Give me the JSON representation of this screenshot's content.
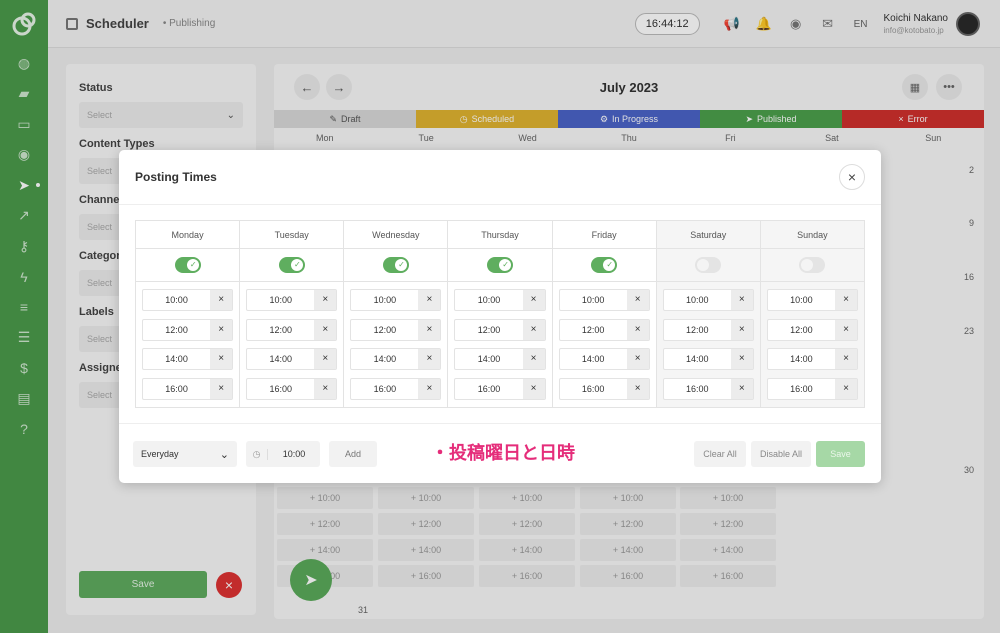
{
  "header": {
    "title": "Scheduler",
    "breadcrumb": "• Publishing",
    "clock": "16:44:12",
    "lang": "EN",
    "user_name": "Koichi Nakano",
    "user_email": "info@kotobato.jp"
  },
  "sidebar": {
    "items": [
      {
        "icon": "palette-icon",
        "glyph": "◍"
      },
      {
        "icon": "folder-icon",
        "glyph": "▰"
      },
      {
        "icon": "inbox-icon",
        "glyph": "▭"
      },
      {
        "icon": "eye-icon",
        "glyph": "◉"
      },
      {
        "icon": "send-icon",
        "glyph": "➤",
        "active": true
      },
      {
        "icon": "chart-icon",
        "glyph": "↗"
      },
      {
        "icon": "key-icon",
        "glyph": "⚷"
      },
      {
        "icon": "bolt-icon",
        "glyph": "ϟ"
      },
      {
        "icon": "sliders-icon",
        "glyph": "≡"
      },
      {
        "icon": "list-icon",
        "glyph": "☰"
      },
      {
        "icon": "dollar-icon",
        "glyph": "$"
      },
      {
        "icon": "id-card-icon",
        "glyph": "▤"
      },
      {
        "icon": "help-icon",
        "glyph": "?"
      }
    ]
  },
  "filters": {
    "status_label": "Status",
    "status_placeholder": "Select",
    "content_types_label": "Content Types",
    "channels_label": "Channels",
    "categories_label": "Categories",
    "labels_label": "Labels",
    "assignee_label": "Assignee",
    "placeholder": "Select",
    "save_label": "Save"
  },
  "calendar": {
    "month": "July 2023",
    "legend": {
      "draft": "Draft",
      "scheduled": "Scheduled",
      "in_progress": "In Progress",
      "published": "Published",
      "error": "Error"
    },
    "days": [
      "Mon",
      "Tue",
      "Wed",
      "Thu",
      "Fri",
      "Sat",
      "Sun"
    ],
    "sun_dates": [
      "2",
      "9",
      "16",
      "23",
      "30"
    ],
    "last_date": "31",
    "slots": [
      "+ 10:00",
      "+ 12:00",
      "+ 14:00",
      "+ 16:00"
    ]
  },
  "modal": {
    "title": "Posting Times",
    "days": [
      {
        "name": "Monday",
        "enabled": true,
        "times": [
          "10:00",
          "12:00",
          "14:00",
          "16:00"
        ]
      },
      {
        "name": "Tuesday",
        "enabled": true,
        "times": [
          "10:00",
          "12:00",
          "14:00",
          "16:00"
        ]
      },
      {
        "name": "Wednesday",
        "enabled": true,
        "times": [
          "10:00",
          "12:00",
          "14:00",
          "16:00"
        ]
      },
      {
        "name": "Thursday",
        "enabled": true,
        "times": [
          "10:00",
          "12:00",
          "14:00",
          "16:00"
        ]
      },
      {
        "name": "Friday",
        "enabled": true,
        "times": [
          "10:00",
          "12:00",
          "14:00",
          "16:00"
        ]
      },
      {
        "name": "Saturday",
        "enabled": false,
        "times": [
          "10:00",
          "12:00",
          "14:00",
          "16:00"
        ]
      },
      {
        "name": "Sunday",
        "enabled": false,
        "times": [
          "10:00",
          "12:00",
          "14:00",
          "16:00"
        ]
      }
    ],
    "footer": {
      "frequency": "Everyday",
      "time": "10:00",
      "add_label": "Add",
      "clear_all_label": "Clear All",
      "disable_all_label": "Disable All",
      "save_label": "Save"
    },
    "annotation": "・投稿曜日と日時"
  }
}
